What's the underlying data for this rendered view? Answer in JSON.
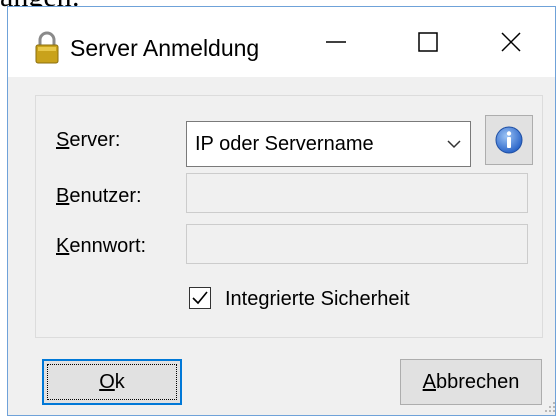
{
  "background_text": "ängen:",
  "window": {
    "title": "Server Anmeldung",
    "title_icon": "lock-icon",
    "controls": {
      "minimize": "minimize-icon",
      "maximize": "maximize-icon",
      "close": "close-icon"
    }
  },
  "form": {
    "server": {
      "label_mnemonic": "S",
      "label_rest": "erver:",
      "value": "IP oder Servername",
      "info_icon": "info-icon"
    },
    "user": {
      "label_mnemonic": "B",
      "label_rest": "enutzer:",
      "value": ""
    },
    "password": {
      "label_mnemonic": "K",
      "label_rest": "ennwort:",
      "value": ""
    },
    "integrated_security": {
      "label": "Integrierte Sicherheit",
      "checked": true
    }
  },
  "buttons": {
    "ok_mnemonic": "O",
    "ok_rest": "k",
    "cancel_mnemonic": "A",
    "cancel_rest": "bbrechen"
  },
  "colors": {
    "window_border": "#6fa2d9",
    "dialog_bg": "#f0f0f0",
    "default_button_border": "#0078d7",
    "info_icon": "#3b78d8"
  }
}
